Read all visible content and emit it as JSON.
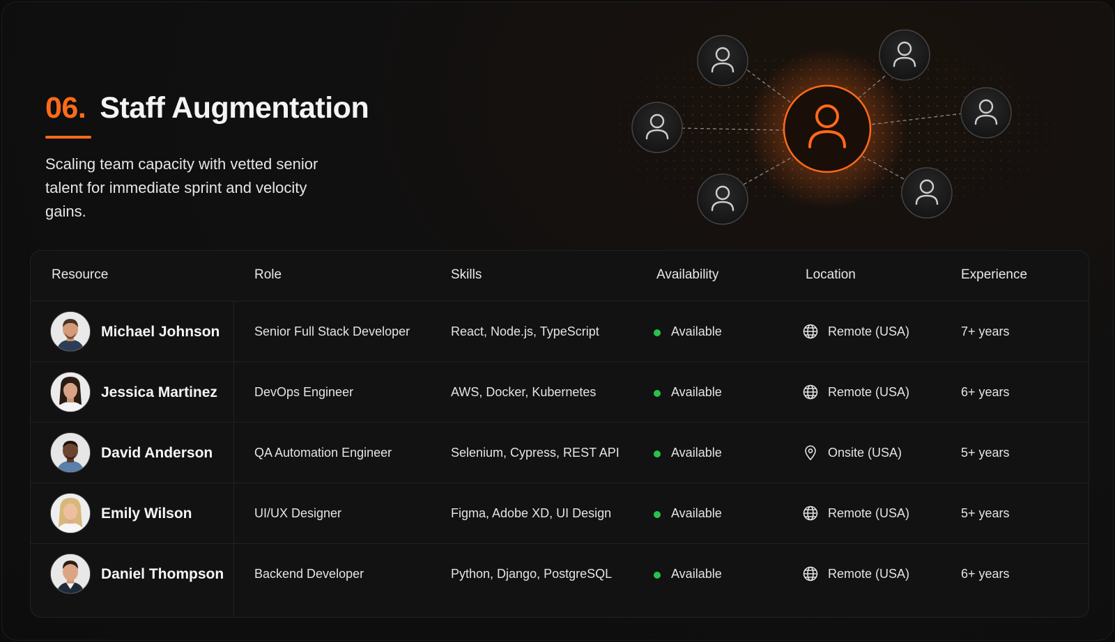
{
  "header": {
    "number": "06.",
    "title": "Staff Augmentation",
    "subtitle": "Scaling team capacity with vetted senior talent for immediate sprint and velocity gains."
  },
  "colors": {
    "accent": "#ff6a1a",
    "available": "#27c24c",
    "background": "#0c0c0c"
  },
  "table": {
    "headers": [
      "Resource",
      "Role",
      "Skills",
      "Availability",
      "Location",
      "Experience"
    ],
    "rows": [
      {
        "name": "Michael Johnson",
        "role": "Senior Full Stack Developer",
        "skills": "React, Node.js, TypeScript",
        "availability": "Available",
        "location_icon": "globe-icon",
        "location": "Remote (USA)",
        "experience": "7+ years"
      },
      {
        "name": "Jessica Martinez",
        "role": "DevOps Engineer",
        "skills": "AWS, Docker, Kubernetes",
        "availability": "Available",
        "location_icon": "globe-icon",
        "location": "Remote (USA)",
        "experience": "6+ years"
      },
      {
        "name": "David Anderson",
        "role": "QA Automation Engineer",
        "skills": "Selenium, Cypress, REST API",
        "availability": "Available",
        "location_icon": "map-pin-icon",
        "location": "Onsite (USA)",
        "experience": "5+ years"
      },
      {
        "name": "Emily Wilson",
        "role": "UI/UX Designer",
        "skills": "Figma, Adobe XD, UI Design",
        "availability": "Available",
        "location_icon": "globe-icon",
        "location": "Remote (USA)",
        "experience": "5+ years"
      },
      {
        "name": "Daniel Thompson",
        "role": "Backend Developer",
        "skills": "Python, Django, PostgreSQL",
        "availability": "Available",
        "location_icon": "globe-icon",
        "location": "Remote (USA)",
        "experience": "6+ years"
      }
    ]
  }
}
